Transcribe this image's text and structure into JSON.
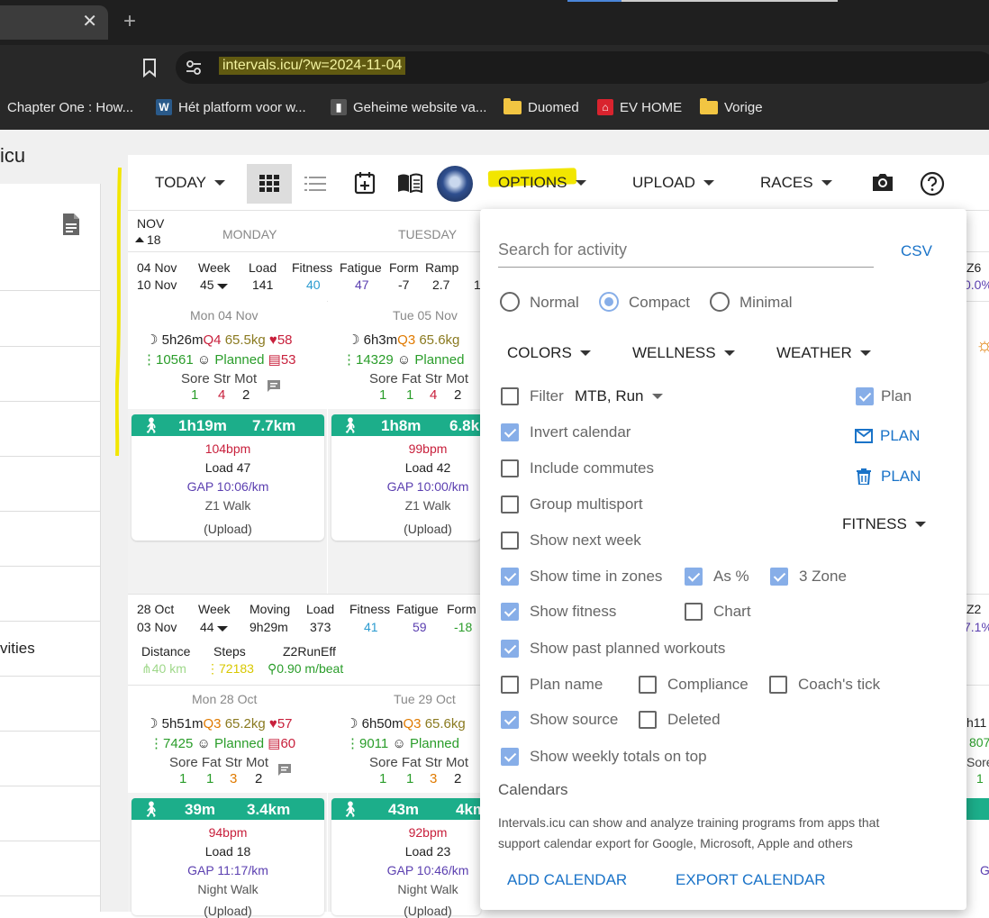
{
  "browser": {
    "url": "intervals.icu/?w=2024-11-04",
    "bookmarks": [
      {
        "label": "Chapter One : How...",
        "icon": "none"
      },
      {
        "label": "Hét platform voor w...",
        "icon": "W"
      },
      {
        "label": "Geheime website va...",
        "icon": "book"
      },
      {
        "label": "Duomed",
        "icon": "folder"
      },
      {
        "label": "EV HOME",
        "icon": "ev"
      },
      {
        "label": "Vorige",
        "icon": "folder"
      }
    ]
  },
  "sidebar": {
    "title": "icu",
    "activities_label": "vities"
  },
  "toolbar": {
    "today": "TODAY",
    "options": "OPTIONS",
    "upload": "UPLOAD",
    "races": "RACES"
  },
  "calendar": {
    "month": "NOV",
    "week_no": "18",
    "days": [
      "MONDAY",
      "TUESDAY"
    ],
    "week1": {
      "from": "04 Nov",
      "to": "10 Nov",
      "headers": [
        "Week",
        "Load",
        "Fitness",
        "Fatigue",
        "Form",
        "Ramp"
      ],
      "values": [
        "45",
        "141",
        "40",
        "47",
        "-7",
        "2.7"
      ],
      "ramp_cut": "1",
      "right_hdr": "Z6",
      "right_val": "0.0%"
    },
    "mon04": {
      "date": "Mon 04 Nov",
      "sleep": "5h26m",
      "sleep_q": "Q4",
      "weight": "65.5kg",
      "hr": "58",
      "steps": "10561",
      "planned": "Planned",
      "hrv": "53",
      "wellness_hdr": "Sore Str Mot",
      "w1": "1",
      "w2": "4",
      "w3": "2",
      "act_time": "1h19m",
      "act_dist": "7.7km",
      "bpm": "104bpm",
      "load": "Load 47",
      "gap": "GAP 10:06/km",
      "name": "Z1 Walk",
      "source": "(Upload)"
    },
    "tue05": {
      "date": "Tue 05 Nov",
      "sleep": "6h3m",
      "sleep_q": "Q3",
      "weight": "65.6kg",
      "steps": "14329",
      "planned": "Planned",
      "wellness_hdr": "Sore Fat Str Mot",
      "w1": "1",
      "w2": "1",
      "w3": "4",
      "w4": "2",
      "act_time": "1h8m",
      "act_dist": "6.8k",
      "bpm": "99bpm",
      "load": "Load 42",
      "gap": "GAP 10:00/km",
      "name": "Z1 Walk",
      "source": "(Upload)"
    },
    "week2": {
      "from": "28 Oct",
      "to": "03 Nov",
      "headers": [
        "Week",
        "Moving",
        "Load",
        "Fitness",
        "Fatigue",
        "Form"
      ],
      "values": [
        "44",
        "9h29m",
        "373",
        "41",
        "59",
        "-18"
      ],
      "extra_hdr": [
        "Distance",
        "Steps",
        "Z2RunEff"
      ],
      "distance": "40 km",
      "steps": "72183",
      "z2": "0.90 m/beat",
      "right_hdr": "Z2",
      "right_val": "7.1%"
    },
    "mon28": {
      "date": "Mon 28 Oct",
      "sleep": "5h51m",
      "sleep_q": "Q3",
      "weight": "65.2kg",
      "hr": "57",
      "steps": "7425",
      "planned": "Planned",
      "hrv": "60",
      "wellness_hdr": "Sore Fat Str Mot",
      "w1": "1",
      "w2": "1",
      "w3": "3",
      "w4": "2",
      "act_time": "39m",
      "act_dist": "3.4km",
      "bpm": "94bpm",
      "load": "Load 18",
      "gap": "GAP 11:17/km",
      "name": "Night Walk",
      "source": "(Upload)"
    },
    "tue29": {
      "date": "Tue 29 Oct",
      "sleep": "6h50m",
      "sleep_q": "Q3",
      "weight": "65.6kg",
      "steps": "9011",
      "planned": "Planned",
      "wellness_hdr": "Sore Fat Str Mot",
      "w1": "1",
      "w2": "1",
      "w3": "3",
      "w4": "2",
      "act_time": "43m",
      "act_dist": "4km",
      "bpm": "92bpm",
      "load": "Load 23",
      "gap": "GAP 10:46/km",
      "name": "Night Walk",
      "source": "(Upload)"
    },
    "right_cut": {
      "h11": "h11",
      "n807": "807",
      "sore": "Sore",
      "one": "1",
      "g": "G"
    }
  },
  "options": {
    "search_placeholder": "Search for activity",
    "csv": "CSV",
    "modes": [
      "Normal",
      "Compact",
      "Minimal"
    ],
    "colors": "COLORS",
    "wellness": "WELLNESS",
    "weather": "WEATHER",
    "filter": "Filter",
    "filter_value": "MTB, Run",
    "plan": "Plan",
    "email_plan": "PLAN",
    "delete_plan": "PLAN",
    "invert": "Invert calendar",
    "commutes": "Include commutes",
    "multisport": "Group multisport",
    "fitness": "FITNESS",
    "next_week": "Show next week",
    "time_in_zones": "Show time in zones",
    "as_pct": "As %",
    "three_zone": "3 Zone",
    "show_fitness": "Show fitness",
    "chart": "Chart",
    "past_planned": "Show past planned workouts",
    "plan_name": "Plan name",
    "compliance": "Compliance",
    "coach_tick": "Coach's tick",
    "show_source": "Show source",
    "deleted": "Deleted",
    "weekly_totals": "Show weekly totals on top",
    "calendars_title": "Calendars",
    "calendars_desc1": "Intervals.icu can show and analyze training programs from apps that",
    "calendars_desc2": "support calendar export for Google, Microsoft, Apple and others",
    "add_calendar": "ADD CALENDAR",
    "export_calendar": "EXPORT CALENDAR"
  }
}
